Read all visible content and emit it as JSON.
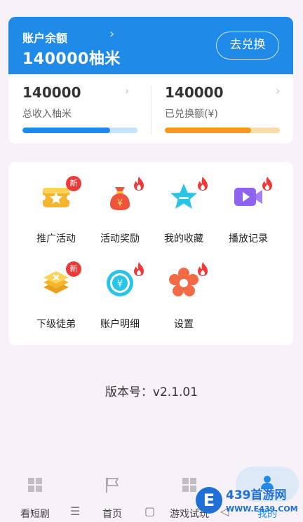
{
  "balance": {
    "label": "账户余额",
    "chevron": "›",
    "amount": "140000柚米",
    "exchange_button": "去兑换"
  },
  "stats": [
    {
      "value": "140000",
      "label": "总收入柚米",
      "chevron": "›",
      "progress": 0.76,
      "fill_color": "#1f8ae8",
      "track_color": "#c7e2fa"
    },
    {
      "value": "140000",
      "label": "已兑换额(¥)",
      "chevron": "›",
      "progress": 0.75,
      "fill_color": "#f39a1a",
      "track_color": "#fbdca8"
    }
  ],
  "menu": [
    {
      "label": "推广活动",
      "icon": "ticket-star-icon",
      "badge": "新"
    },
    {
      "label": "活动奖励",
      "icon": "money-bag-icon",
      "badge": "flame"
    },
    {
      "label": "我的收藏",
      "icon": "star-icon",
      "badge": "flame"
    },
    {
      "label": "播放记录",
      "icon": "video-camera-icon",
      "badge": "flame"
    },
    {
      "label": "下级徒弟",
      "icon": "stacked-layers-icon",
      "badge": "新"
    },
    {
      "label": "账户明细",
      "icon": "yuan-coin-icon",
      "badge": "flame"
    },
    {
      "label": "设置",
      "icon": "settings-flower-icon",
      "badge": "flame"
    }
  ],
  "version": "版本号：v2.1.01",
  "tabs": [
    {
      "label": "看短剧",
      "icon": "grid-icon"
    },
    {
      "label": "首页",
      "icon": "flag-icon"
    },
    {
      "label": "游戏试玩",
      "icon": "grid-icon"
    },
    {
      "label": "我的",
      "icon": "user-icon",
      "active": true
    }
  ],
  "system_nav": [
    "☰",
    "▢",
    "◁"
  ],
  "watermark": {
    "brand": "439首游网",
    "url": "WWW.E439.COM",
    "letter": "E"
  },
  "colors": {
    "primary": "#1f8ae8",
    "orange": "#f39a1a",
    "badge_red": "#ef3a3a"
  }
}
